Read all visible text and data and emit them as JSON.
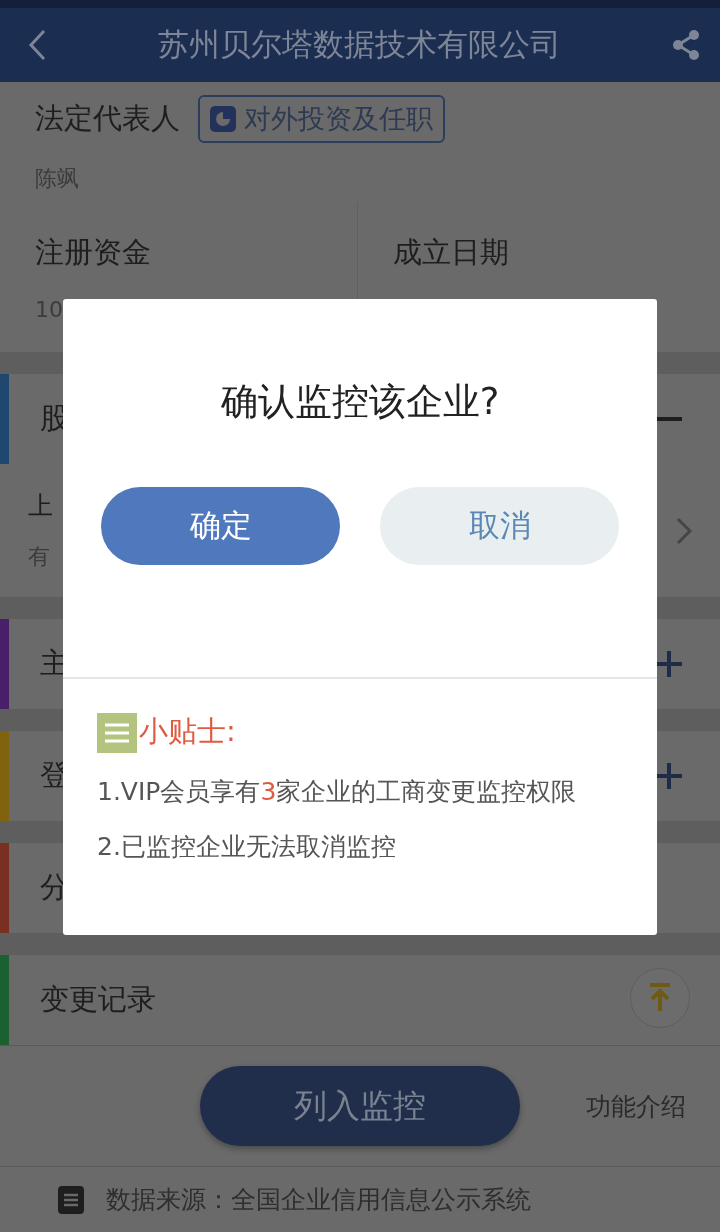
{
  "header": {
    "title": "苏州贝尔塔数据技术有限公司"
  },
  "legal_rep": {
    "label": "法定代表人",
    "link": "对外投资及任职",
    "name": "陈飒"
  },
  "stats": [
    {
      "label": "注册资金",
      "value": "10"
    },
    {
      "label": "成立日期"
    }
  ],
  "items": [
    {
      "kind": "section",
      "title": "股",
      "color": "#1f4770",
      "expanded": true
    },
    {
      "kind": "entry",
      "line_1": "上",
      "line_2": "有"
    },
    {
      "kind": "section",
      "title": "主",
      "color": "#4a1f6a",
      "expanded": false
    },
    {
      "kind": "section",
      "title": "登",
      "color": "#80620f",
      "expanded": false
    },
    {
      "kind": "section",
      "title": "分",
      "color": "#7a3020"
    },
    {
      "kind": "section",
      "title": "变更记录",
      "color": "#1a6030"
    }
  ],
  "footer": {
    "monitor_button": "列入监控",
    "intro_link": "功能介绍",
    "source": "数据来源：全国企业信用信息公示系统"
  },
  "dialog": {
    "title": "确认监控该企业?",
    "buttons": [
      {
        "label": "确定",
        "kind": "primary"
      },
      {
        "label": "取消",
        "kind": "secondary"
      }
    ],
    "tips_title": "小贴士:",
    "tips": [
      {
        "before": "1.VIP会员享有",
        "highlight": "3",
        "after": "家企业的工商变更监控权限"
      },
      {
        "before": "2.已监控企业无法取消监控"
      }
    ]
  }
}
